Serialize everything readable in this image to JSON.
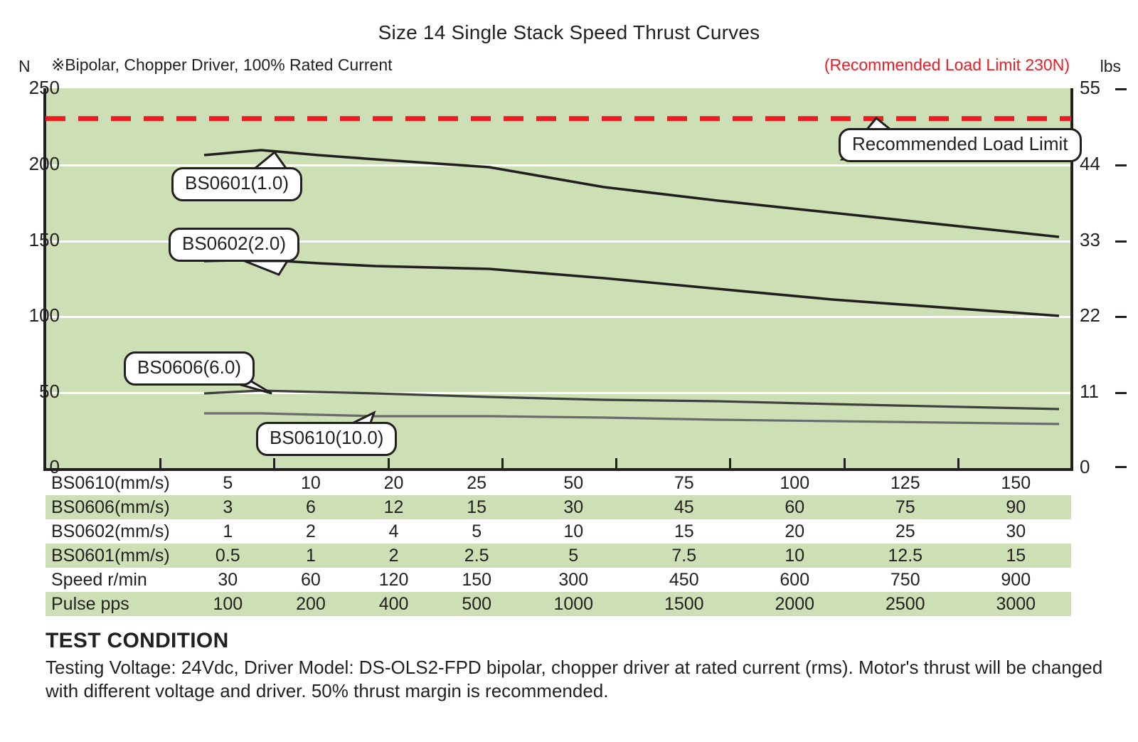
{
  "header": {
    "title": "Size 14 Single Stack Speed Thrust Curves",
    "left_unit": "N",
    "right_unit": "lbs",
    "sub_note": "※Bipolar, Chopper Driver, 100% Rated Current",
    "load_limit_note": "(Recommended Load Limit 230N)"
  },
  "colors": {
    "plot_background": "#cddfb4",
    "gridline": "#ffffff",
    "limit_line": "#ee1b24",
    "curve_dark": "#231f20",
    "curve_gray": "#585858",
    "text": "#231f20",
    "table_shaded_row": "#cddfb4"
  },
  "callouts": [
    {
      "label": "BS0601(1.0)",
      "name": "callout-bs0601"
    },
    {
      "label": "BS0602(2.0)",
      "name": "callout-bs0602"
    },
    {
      "label": "BS0606(6.0)",
      "name": "callout-bs0606"
    },
    {
      "label": "BS0610(10.0)",
      "name": "callout-bs0610"
    },
    {
      "label": "Recommended Load Limit",
      "name": "callout-load-limit"
    }
  ],
  "axes": {
    "left_ticks": [
      "250",
      "200",
      "150",
      "100",
      "50",
      "0"
    ],
    "right_ticks": [
      "55",
      "44",
      "33",
      "22",
      "11",
      "0"
    ]
  },
  "table": {
    "rows": [
      {
        "label": "BS0610(mm/s)",
        "values": [
          "5",
          "10",
          "20",
          "25",
          "50",
          "75",
          "100",
          "125",
          "150"
        ],
        "shaded": false
      },
      {
        "label": "BS0606(mm/s)",
        "values": [
          "3",
          "6",
          "12",
          "15",
          "30",
          "45",
          "60",
          "75",
          "90"
        ],
        "shaded": true
      },
      {
        "label": "BS0602(mm/s)",
        "values": [
          "1",
          "2",
          "4",
          "5",
          "10",
          "15",
          "20",
          "25",
          "30"
        ],
        "shaded": false
      },
      {
        "label": "BS0601(mm/s)",
        "values": [
          "0.5",
          "1",
          "2",
          "2.5",
          "5",
          "7.5",
          "10",
          "12.5",
          "15"
        ],
        "shaded": true
      },
      {
        "label": "Speed r/min",
        "values": [
          "30",
          "60",
          "120",
          "150",
          "300",
          "450",
          "600",
          "750",
          "900"
        ],
        "shaded": false
      },
      {
        "label": "Pulse  pps",
        "values": [
          "100",
          "200",
          "400",
          "500",
          "1000",
          "1500",
          "2000",
          "2500",
          "3000"
        ],
        "shaded": true
      }
    ]
  },
  "footer": {
    "heading": "TEST CONDITION",
    "body": "Testing Voltage: 24Vdc, Driver Model: DS-OLS2-FPD bipolar, chopper driver at rated current (rms). Motor's thrust will be changed with different voltage and driver. 50% thrust margin is recommended."
  },
  "chart_data": {
    "type": "line",
    "title": "Size 14 Single Stack Speed Thrust Curves",
    "xlabel": "Pulse pps / Speed r/min",
    "ylabel": "Thrust (N)",
    "ylim": [
      0,
      250
    ],
    "y2lim": [
      0,
      55
    ],
    "y2label": "Thrust (lbs)",
    "yticks": [
      0,
      50,
      100,
      150,
      200,
      250
    ],
    "y2ticks": [
      0,
      11,
      22,
      33,
      44,
      55
    ],
    "grid": true,
    "legend": "inline-callouts",
    "x_pulse_pps": [
      100,
      200,
      400,
      500,
      1000,
      1500,
      2000,
      2500,
      3000
    ],
    "x_speed_rpm": [
      30,
      60,
      120,
      150,
      300,
      450,
      600,
      750,
      900
    ],
    "annotations": [
      {
        "text": "Recommended Load Limit",
        "y": 230,
        "style": "red-dashed-line"
      }
    ],
    "series": [
      {
        "name": "BS0601(1.0)",
        "color": "#231f20",
        "values": [
          206,
          209,
          206,
          203,
          198,
          185,
          176,
          168,
          152
        ]
      },
      {
        "name": "BS0602(2.0)",
        "color": "#231f20",
        "values": [
          136,
          137,
          135,
          133,
          131,
          125,
          118,
          111,
          100
        ]
      },
      {
        "name": "BS0606(6.0)",
        "color": "#3f3f3f",
        "values": [
          49,
          51,
          50,
          49,
          47,
          45,
          44,
          42,
          39
        ]
      },
      {
        "name": "BS0610(10.0)",
        "color": "#6b6b6b",
        "values": [
          36,
          36,
          35,
          34,
          34,
          33,
          32,
          31,
          29
        ]
      }
    ]
  }
}
